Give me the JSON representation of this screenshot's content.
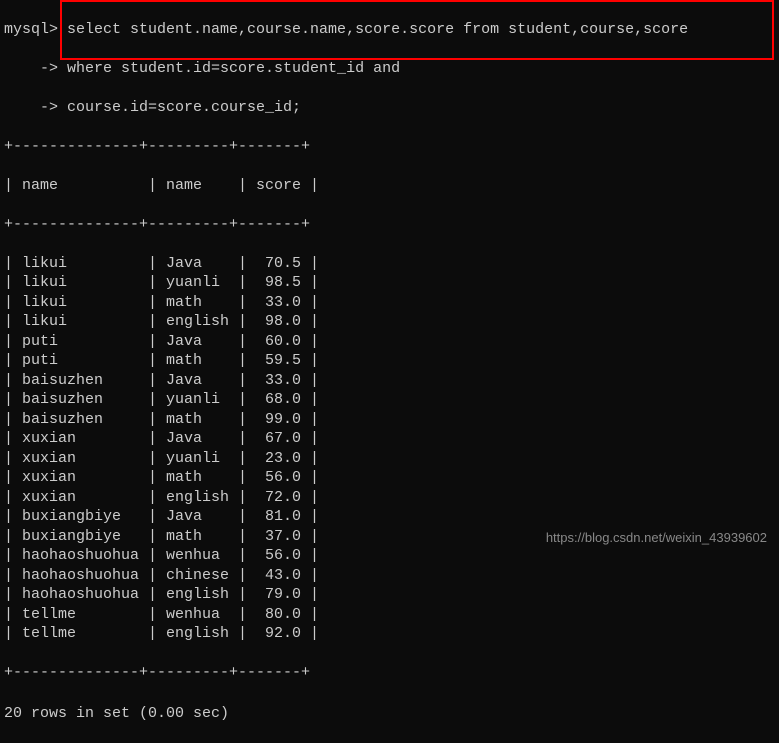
{
  "prompt": {
    "mysql": "mysql>",
    "cont": "    ->",
    "query_line1": " select student.name,course.name,score.score from student,course,score",
    "query_line2": " where student.id=score.student_id and",
    "query_line3": " course.id=score.course_id;"
  },
  "table": {
    "border_top": "+--------------+---------+-------+",
    "border_mid": "+--------------+---------+-------+",
    "border_bot": "+--------------+---------+-------+",
    "headers": [
      "name",
      "name",
      "score"
    ],
    "header_row": "| name          | name    | score |",
    "rows": [
      {
        "name": "likui",
        "course": "Java",
        "score": "70.5"
      },
      {
        "name": "likui",
        "course": "yuanli",
        "score": "98.5"
      },
      {
        "name": "likui",
        "course": "math",
        "score": "33.0"
      },
      {
        "name": "likui",
        "course": "english",
        "score": "98.0"
      },
      {
        "name": "puti",
        "course": "Java",
        "score": "60.0"
      },
      {
        "name": "puti",
        "course": "math",
        "score": "59.5"
      },
      {
        "name": "baisuzhen",
        "course": "Java",
        "score": "33.0"
      },
      {
        "name": "baisuzhen",
        "course": "yuanli",
        "score": "68.0"
      },
      {
        "name": "baisuzhen",
        "course": "math",
        "score": "99.0"
      },
      {
        "name": "xuxian",
        "course": "Java",
        "score": "67.0"
      },
      {
        "name": "xuxian",
        "course": "yuanli",
        "score": "23.0"
      },
      {
        "name": "xuxian",
        "course": "math",
        "score": "56.0"
      },
      {
        "name": "xuxian",
        "course": "english",
        "score": "72.0"
      },
      {
        "name": "buxiangbiye",
        "course": "Java",
        "score": "81.0"
      },
      {
        "name": "buxiangbiye",
        "course": "math",
        "score": "37.0"
      },
      {
        "name": "haohaoshuohua",
        "course": "wenhua",
        "score": "56.0"
      },
      {
        "name": "haohaoshuohua",
        "course": "chinese",
        "score": "43.0"
      },
      {
        "name": "haohaoshuohua",
        "course": "english",
        "score": "79.0"
      },
      {
        "name": "tellme",
        "course": "wenhua",
        "score": "80.0"
      },
      {
        "name": "tellme",
        "course": "english",
        "score": "92.0"
      }
    ]
  },
  "status": "20 rows in set (0.00 sec)",
  "watermark": "https://blog.csdn.net/weixin_43939602"
}
